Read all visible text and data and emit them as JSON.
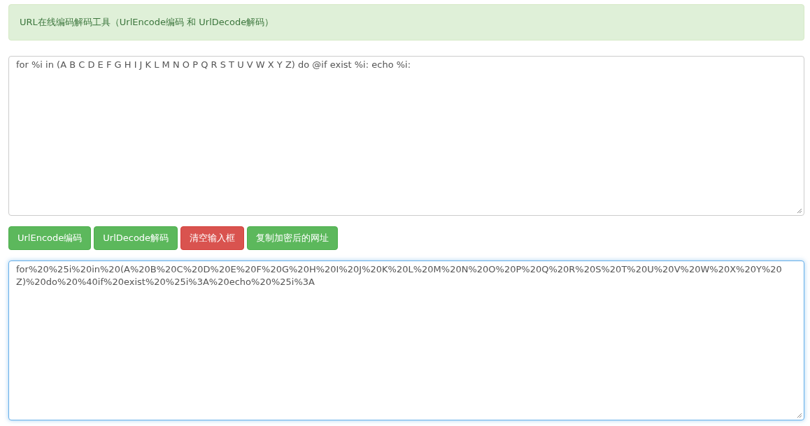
{
  "alert": {
    "text": "URL在线编码解码工具（UrlEncode编码 和 UrlDecode解码）"
  },
  "input": {
    "value": "for %i in (A B C D E F G H I J K L M N O P Q R S T U V W X Y Z) do @if exist %i: echo %i:",
    "focused": false
  },
  "buttons": [
    {
      "label": "UrlEncode编码",
      "kind": "success"
    },
    {
      "label": "UrlDecode解码",
      "kind": "success"
    },
    {
      "label": "清空输入框",
      "kind": "danger"
    },
    {
      "label": "复制加密后的网址",
      "kind": "success"
    }
  ],
  "output": {
    "value": "for%20%25i%20in%20(A%20B%20C%20D%20E%20F%20G%20H%20I%20J%20K%20L%20M%20N%20O%20P%20Q%20R%20S%20T%20U%20V%20W%20X%20Y%20Z)%20do%20%40if%20exist%20%25i%3A%20echo%20%25i%3A",
    "focused": true
  }
}
